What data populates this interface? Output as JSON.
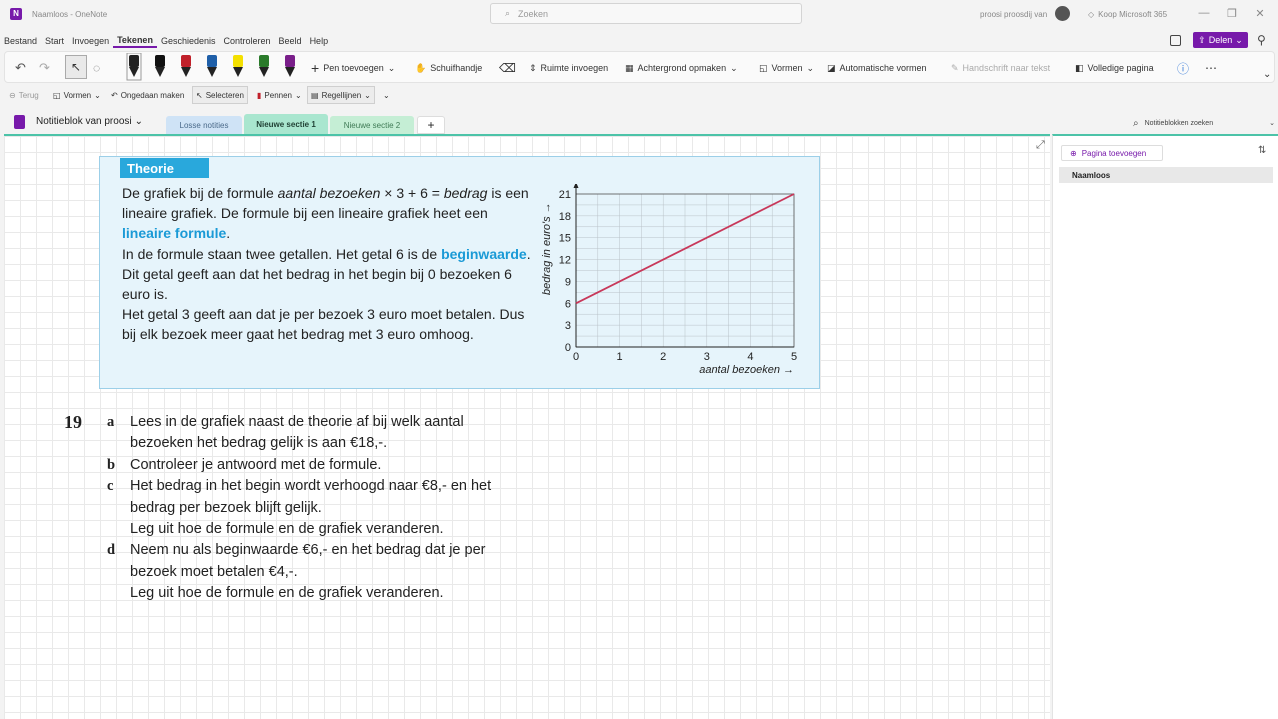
{
  "titlebar": {
    "app_title": "Naamloos - OneNote",
    "search_placeholder": "Zoeken",
    "user": "proosi proosdij van",
    "buy": "Koop Microsoft 365"
  },
  "menu": {
    "items": [
      "Bestand",
      "Start",
      "Invoegen",
      "Tekenen",
      "Geschiedenis",
      "Controleren",
      "Beeld",
      "Help"
    ],
    "share": "Delen"
  },
  "ribbon": {
    "pen_add": "Pen toevoegen",
    "hand": "Schuifhandje",
    "space": "Ruimte invoegen",
    "background": "Achtergrond opmaken",
    "shapes": "Vormen",
    "auto_shapes": "Automatische vormen",
    "ink_to_text": "Handschrift naar tekst",
    "full_page": "Volledige pagina",
    "pen_colors": [
      "#222222",
      "#111111",
      "#c0202a",
      "#1f5fa8",
      "#f4e000",
      "#2a7a2a",
      "#7a1f8a"
    ]
  },
  "toolbar2": {
    "back": "Terug",
    "shapes": "Vormen",
    "undo": "Ongedaan maken",
    "select": "Selecteren",
    "pens": "Pennen",
    "lines": "Regellijnen"
  },
  "tabs": {
    "notebook": "Notitieblok van proosi",
    "sections": [
      "Losse notities",
      "Nieuwe sectie 1",
      "Nieuwe sectie 2"
    ],
    "add": "+",
    "search_notebooks": "Notitieblokken zoeken"
  },
  "pages": {
    "add_page": "Pagina toevoegen",
    "items": [
      "Naamloos"
    ]
  },
  "theory": {
    "heading": "Theorie",
    "p1_a": "De grafiek bij de formule ",
    "p1_i": "aantal bezoeken",
    "p1_b": " × 3 + 6 = ",
    "p1_i2": "bedrag",
    "p1_c": " is een lineaire grafiek. De formule bij een lineaire grafiek heet een ",
    "p1_hl": "lineaire formule",
    "p1_d": ".",
    "p2_a": "In de formule staan twee getallen. Het getal 6 is de ",
    "p2_hl": "beginwaarde",
    "p2_b": ". Dit getal geeft aan dat het bedrag in het begin bij 0 bezoeken 6 euro is.",
    "p3": "Het getal 3 geeft aan dat je per bezoek 3 euro moet betalen. Dus bij elk bezoek meer gaat het bedrag met 3 euro omhoog."
  },
  "chart_data": {
    "type": "line",
    "x": [
      0,
      5
    ],
    "series": [
      {
        "values": [
          6,
          21
        ],
        "color": "#c8385a"
      }
    ],
    "xlabel": "aantal bezoeken →",
    "ylabel": "bedrag in euro's →",
    "xticks": [
      0,
      1,
      2,
      3,
      4,
      5
    ],
    "yticks": [
      0,
      3,
      6,
      9,
      12,
      15,
      18,
      21
    ],
    "xlim": [
      0,
      5
    ],
    "ylim": [
      0,
      21
    ],
    "grid": true
  },
  "exercise": {
    "number": "19",
    "items": [
      {
        "letter": "a",
        "lines": [
          "Lees in de grafiek naast de theorie af bij welk aantal",
          "bezoeken het bedrag gelijk is aan €18,-."
        ]
      },
      {
        "letter": "b",
        "lines": [
          "Controleer je antwoord met de formule."
        ]
      },
      {
        "letter": "c",
        "lines": [
          "Het bedrag in het begin wordt verhoogd naar €8,- en het",
          "bedrag per bezoek blijft gelijk.",
          "Leg uit hoe de formule en de grafiek veranderen."
        ]
      },
      {
        "letter": "d",
        "lines": [
          "Neem nu als beginwaarde €6,- en het bedrag dat je per",
          "bezoek moet betalen €4,-.",
          "Leg uit hoe de formule en de grafiek veranderen."
        ]
      }
    ]
  }
}
